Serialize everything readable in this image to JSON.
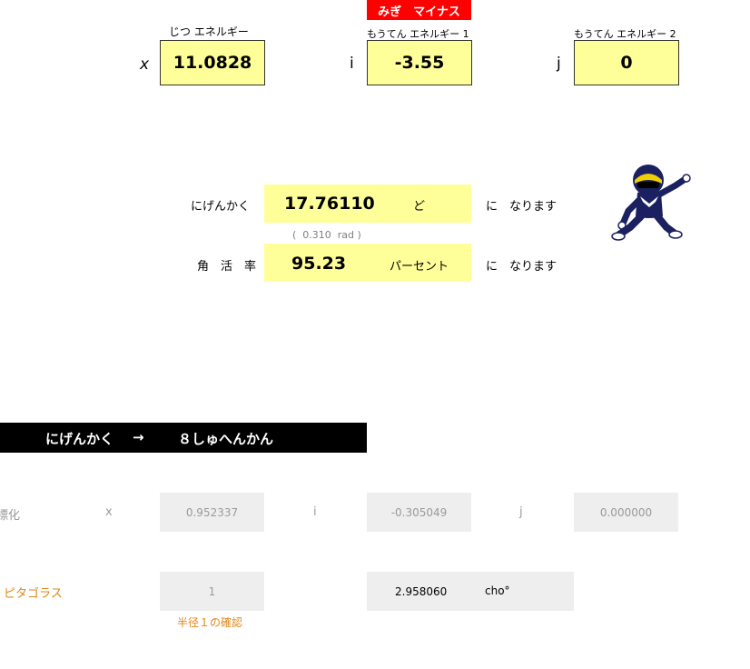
{
  "inputs": {
    "real_header": "じつ エネルギー",
    "real_var": "x",
    "real_value": "11.0828",
    "warning_badge": "みぎ　マイナス",
    "imag1_header": "もうてん エネルギー 1",
    "imag1_var": "i",
    "imag1_value": "-3.55",
    "imag2_header": "もうてん エネルギー 2",
    "imag2_var": "j",
    "imag2_value": "0"
  },
  "results": {
    "angle_label": "にげんかく",
    "angle_value": "17.76110",
    "angle_unit": "ど",
    "angle_suffix": "に　なります",
    "rad_note": "(  0.310  rad )",
    "rate_label": "角　活　率",
    "rate_value": "95.23",
    "rate_unit": "パーセント",
    "rate_suffix": "に　なります"
  },
  "section_bar": {
    "left": "にげんかく",
    "arrow": "→",
    "right": "８しゅへんかん"
  },
  "normalized": {
    "label": "標化",
    "x_var": "x",
    "x_value": "0.952337",
    "i_var": "i",
    "i_value": "-0.305049",
    "j_var": "j",
    "j_value": "0.000000"
  },
  "pythagoras": {
    "label": "ピタゴラス",
    "value": "1",
    "note": "半径１の確認",
    "angle_value": "2.958060",
    "angle_unit": "cho°"
  },
  "colors": {
    "input_fill": "#ffff99",
    "badge_red": "#ff0000",
    "section_black": "#000000",
    "grey_fill": "#eeeeee",
    "orange_text": "#e0861a",
    "mascot_navy": "#1a2060"
  },
  "icons": {
    "mascot": "ranger-mascot-icon"
  }
}
